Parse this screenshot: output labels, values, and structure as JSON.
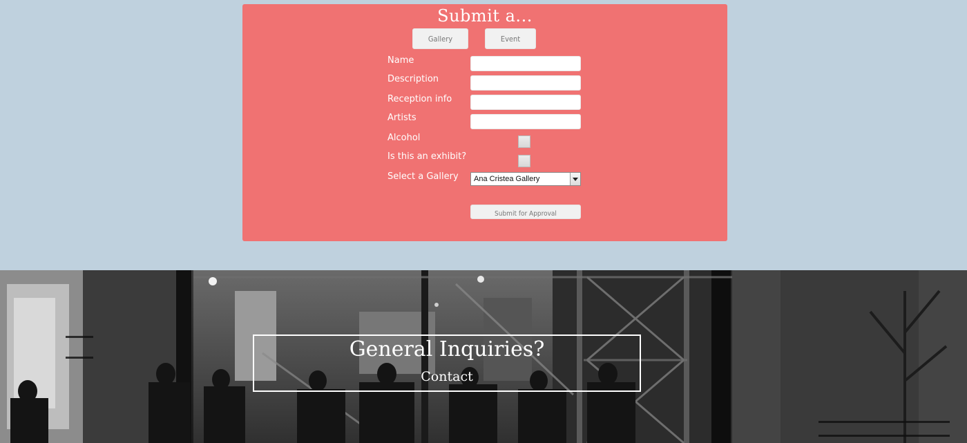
{
  "form": {
    "title": "Submit a...",
    "type_buttons": {
      "gallery": "Gallery",
      "event": "Event"
    },
    "fields": {
      "name": {
        "label": "Name",
        "value": ""
      },
      "description": {
        "label": "Description",
        "value": ""
      },
      "reception_info": {
        "label": "Reception info",
        "value": ""
      },
      "artists": {
        "label": "Artists",
        "value": ""
      },
      "alcohol": {
        "label": "Alcohol",
        "checked": false
      },
      "is_exhibit": {
        "label": "Is this an exhibit?",
        "checked": false
      },
      "gallery_select": {
        "label": "Select a Gallery",
        "value": "Ana Cristea Gallery"
      }
    },
    "submit_label": "Submit for Approval"
  },
  "footer": {
    "heading": "General Inquiries?",
    "contact_link": "Contact"
  },
  "colors": {
    "page_bg": "#bfd1de",
    "panel_bg": "#f07272",
    "button_bg": "#f1f1f1"
  }
}
